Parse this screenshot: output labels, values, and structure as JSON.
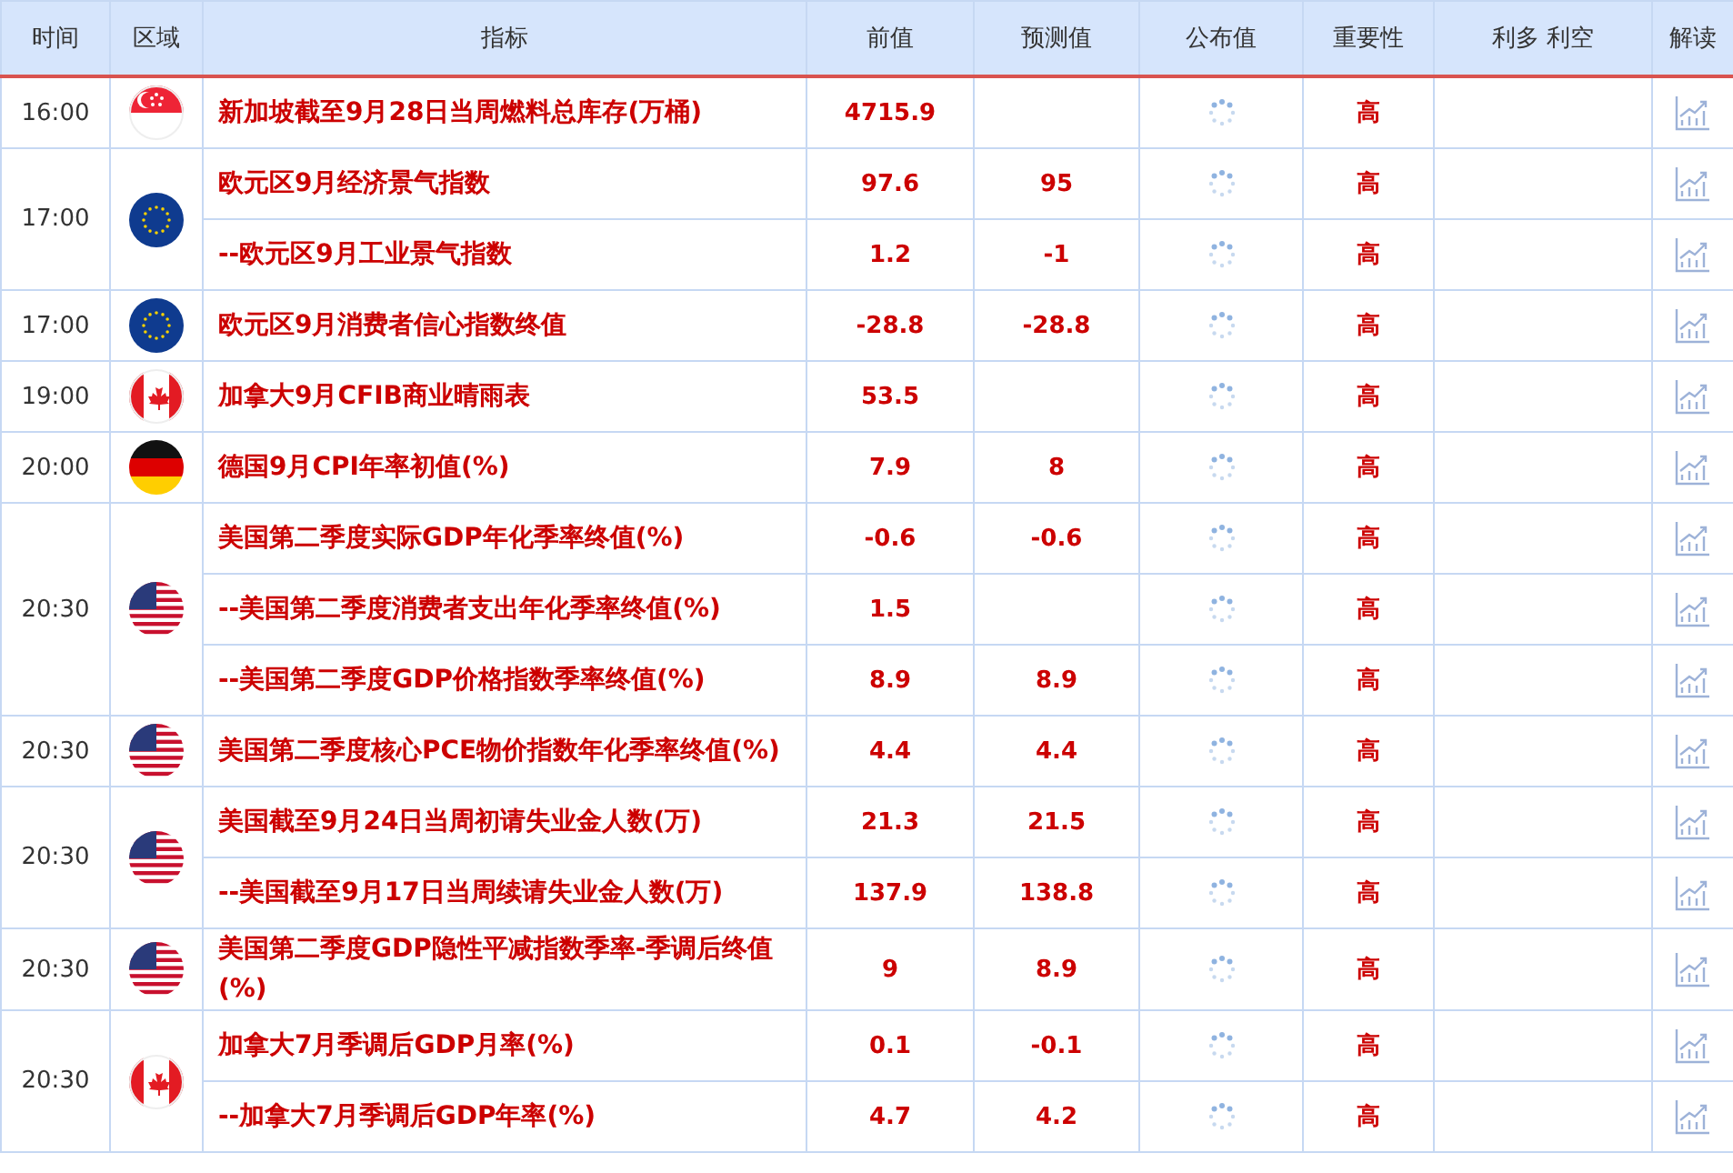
{
  "columns": [
    "时间",
    "区域",
    "指标",
    "前值",
    "预测值",
    "公布值",
    "重要性",
    "利多 利空",
    "解读"
  ],
  "groups": [
    {
      "time": "16:00",
      "kind": "sg",
      "items": [
        {
          "indicator": "新加坡截至9月28日当周燃料总库存(万桶)",
          "previous": "4715.9",
          "importance": "高"
        }
      ]
    },
    {
      "time": "17:00",
      "kind": "eu",
      "items": [
        {
          "indicator": "欧元区9月经济景气指数",
          "previous": "97.6",
          "forecast": "95",
          "importance": "高"
        },
        {
          "indicator": "--欧元区9月工业景气指数",
          "previous": "1.2",
          "forecast": "-1",
          "importance": "高"
        }
      ]
    },
    {
      "time": "17:00",
      "kind": "eu",
      "items": [
        {
          "indicator": "欧元区9月消费者信心指数终值",
          "previous": "-28.8",
          "forecast": "-28.8",
          "importance": "高"
        }
      ]
    },
    {
      "time": "19:00",
      "kind": "ca",
      "items": [
        {
          "indicator": "加拿大9月CFIB商业晴雨表",
          "previous": "53.5",
          "importance": "高"
        }
      ]
    },
    {
      "time": "20:00",
      "kind": "de",
      "items": [
        {
          "indicator": "德国9月CPI年率初值(%)",
          "previous": "7.9",
          "forecast": "8",
          "importance": "高"
        }
      ]
    },
    {
      "time": "20:30",
      "kind": "us",
      "items": [
        {
          "indicator": "美国第二季度实际GDP年化季率终值(%)",
          "previous": "-0.6",
          "forecast": "-0.6",
          "importance": "高"
        },
        {
          "indicator": "--美国第二季度消费者支出年化季率终值(%)",
          "previous": "1.5",
          "importance": "高"
        },
        {
          "indicator": "--美国第二季度GDP价格指数季率终值(%)",
          "previous": "8.9",
          "forecast": "8.9",
          "importance": "高"
        }
      ]
    },
    {
      "time": "20:30",
      "kind": "us",
      "items": [
        {
          "indicator": "美国第二季度核心PCE物价指数年化季率终值(%)",
          "previous": "4.4",
          "forecast": "4.4",
          "importance": "高"
        }
      ]
    },
    {
      "time": "20:30",
      "kind": "us",
      "items": [
        {
          "indicator": "美国截至9月24日当周初请失业金人数(万)",
          "previous": "21.3",
          "forecast": "21.5",
          "importance": "高"
        },
        {
          "indicator": "--美国截至9月17日当周续请失业金人数(万)",
          "previous": "137.9",
          "forecast": "138.8",
          "importance": "高"
        }
      ]
    },
    {
      "time": "20:30",
      "kind": "us",
      "items": [
        {
          "indicator": "美国第二季度GDP隐性平减指数季率-季调后终值(%)",
          "previous": "9",
          "forecast": "8.9",
          "importance": "高"
        }
      ]
    },
    {
      "time": "20:30",
      "kind": "ca",
      "items": [
        {
          "indicator": "加拿大7月季调后GDP月率(%)",
          "previous": "0.1",
          "forecast": "-0.1",
          "importance": "高"
        },
        {
          "indicator": "--加拿大7月季调后GDP年率(%)",
          "previous": "4.7",
          "forecast": "4.2",
          "importance": "高"
        }
      ]
    }
  ]
}
